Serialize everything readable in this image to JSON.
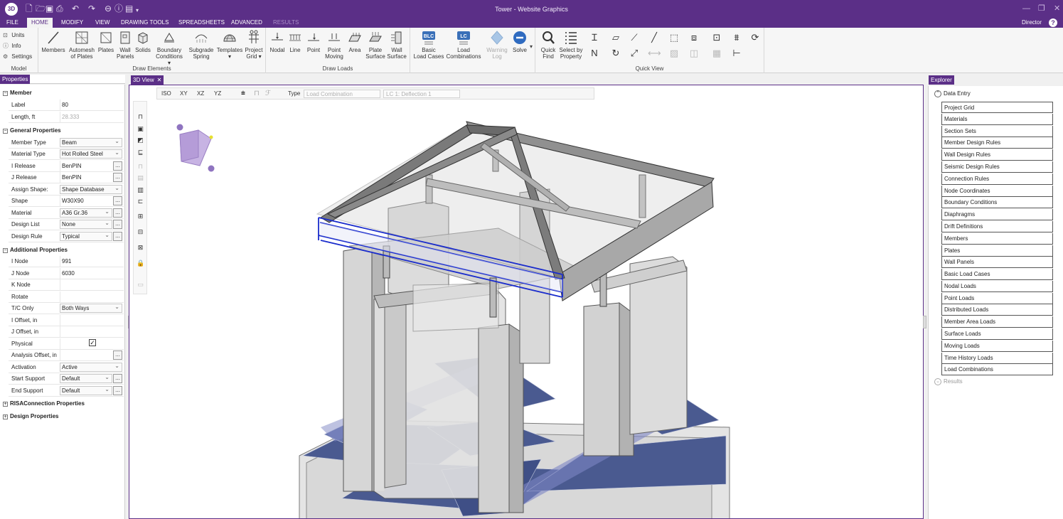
{
  "window": {
    "title": "Tower - Website Graphics",
    "logo": "3D"
  },
  "ribbon_tabs": [
    {
      "label": "FILE",
      "state": "normal"
    },
    {
      "label": "HOME",
      "state": "active"
    },
    {
      "label": "MODIFY",
      "state": "normal"
    },
    {
      "label": "VIEW",
      "state": "normal"
    },
    {
      "label": "DRAWING TOOLS",
      "state": "normal"
    },
    {
      "label": "SPREADSHEETS",
      "state": "normal"
    },
    {
      "label": "ADVANCED",
      "state": "normal"
    },
    {
      "label": "RESULTS",
      "state": "disabled"
    }
  ],
  "user": "Director",
  "ribbon": {
    "model": {
      "label": "Model",
      "units": "Units",
      "info": "Info",
      "settings": "Settings"
    },
    "draw_elements": {
      "label": "Draw Elements",
      "buttons": [
        {
          "l1": "Members",
          "l2": ""
        },
        {
          "l1": "Automesh",
          "l2": "of Plates"
        },
        {
          "l1": "Plates",
          "l2": ""
        },
        {
          "l1": "Wall",
          "l2": "Panels"
        },
        {
          "l1": "Solids",
          "l2": ""
        },
        {
          "l1": "Boundary",
          "l2": "Conditions ▾"
        },
        {
          "l1": "Subgrade",
          "l2": "Spring"
        },
        {
          "l1": "Templates",
          "l2": "▾"
        },
        {
          "l1": "Project",
          "l2": "Grid ▾"
        }
      ]
    },
    "draw_loads": {
      "label": "Draw Loads",
      "buttons": [
        {
          "l1": "Nodal",
          "l2": ""
        },
        {
          "l1": "Line",
          "l2": ""
        },
        {
          "l1": "Point",
          "l2": ""
        },
        {
          "l1": "Point",
          "l2": "Moving"
        },
        {
          "l1": "Area",
          "l2": ""
        },
        {
          "l1": "Plate",
          "l2": "Surface"
        },
        {
          "l1": "Wall",
          "l2": "Surface"
        }
      ]
    },
    "solve_group": {
      "buttons": [
        {
          "l1": "Basic",
          "l2": "Load Cases",
          "badge": "BLC"
        },
        {
          "l1": "Load",
          "l2": "Combinations",
          "badge": "LC"
        },
        {
          "l1": "Warning",
          "l2": "Log",
          "disabled": true
        },
        {
          "l1": "Solve",
          "l2": ""
        }
      ]
    },
    "quick_view": {
      "label": "Quick View",
      "buttons": [
        {
          "l1": "Quick",
          "l2": "Find"
        },
        {
          "l1": "Select by",
          "l2": "Property"
        }
      ]
    }
  },
  "properties": {
    "tab": "Properties",
    "member": {
      "section": "Member",
      "label_key": "Label",
      "label_val": "80",
      "length_key": "Length, ft",
      "length_val": "28.333"
    },
    "general": {
      "section": "General Properties",
      "rows": [
        {
          "k": "Member Type",
          "v": "Beam"
        },
        {
          "k": "Material Type",
          "v": "Hot Rolled Steel"
        },
        {
          "k": "I Release",
          "v": "BenPIN"
        },
        {
          "k": "J Release",
          "v": "BenPIN"
        },
        {
          "k": "Assign Shape:",
          "v": "Shape Database"
        },
        {
          "k": "Shape",
          "v": "W30X90"
        },
        {
          "k": "Material",
          "v": "A36 Gr.36"
        },
        {
          "k": "Design List",
          "v": "None"
        },
        {
          "k": "Design Rule",
          "v": "Typical"
        }
      ]
    },
    "additional": {
      "section": "Additional Properties",
      "rows": [
        {
          "k": "I Node",
          "v": "991"
        },
        {
          "k": "J Node",
          "v": "6030"
        },
        {
          "k": "K Node",
          "v": ""
        },
        {
          "k": "Rotate",
          "v": ""
        },
        {
          "k": "T/C Only",
          "v": "Both Ways"
        },
        {
          "k": "I Offset, in",
          "v": ""
        },
        {
          "k": "J Offset, in",
          "v": ""
        },
        {
          "k": "Physical",
          "v": "✓"
        },
        {
          "k": "Analysis Offset, in",
          "v": ""
        },
        {
          "k": "Activation",
          "v": "Active"
        },
        {
          "k": "Start Support",
          "v": "Default"
        },
        {
          "k": "End Support",
          "v": "Default"
        }
      ]
    },
    "risa_connection": "RISAConnection Properties",
    "design_properties": "Design Properties"
  },
  "view": {
    "tab": "3D View",
    "toolbar": {
      "iso": "ISO",
      "xy": "XY",
      "xz": "XZ",
      "yz": "YZ",
      "type_label": "Type",
      "type_value": "Load Combination",
      "lc_value": "LC 1: Deflection 1"
    }
  },
  "explorer": {
    "tab": "Explorer",
    "root": "Data Entry",
    "items": [
      "Project Grid",
      "Materials",
      "Section Sets",
      "Member Design Rules",
      "Wall Design Rules",
      "Seismic Design Rules",
      "Connection Rules",
      "Node Coordinates",
      "Boundary Conditions",
      "Diaphragms",
      "Drift Definitions",
      "Members",
      "Plates",
      "Wall Panels",
      "Basic Load Cases",
      "Nodal Loads",
      "Point Loads",
      "Distributed Loads",
      "Member Area Loads",
      "Surface Loads",
      "Moving Loads",
      "Time History Loads",
      "Load Combinations"
    ],
    "results": "Results"
  },
  "colors": {
    "accent": "#5b2f87",
    "selection": "#1a2ccc",
    "tile": "#3f4f86"
  }
}
